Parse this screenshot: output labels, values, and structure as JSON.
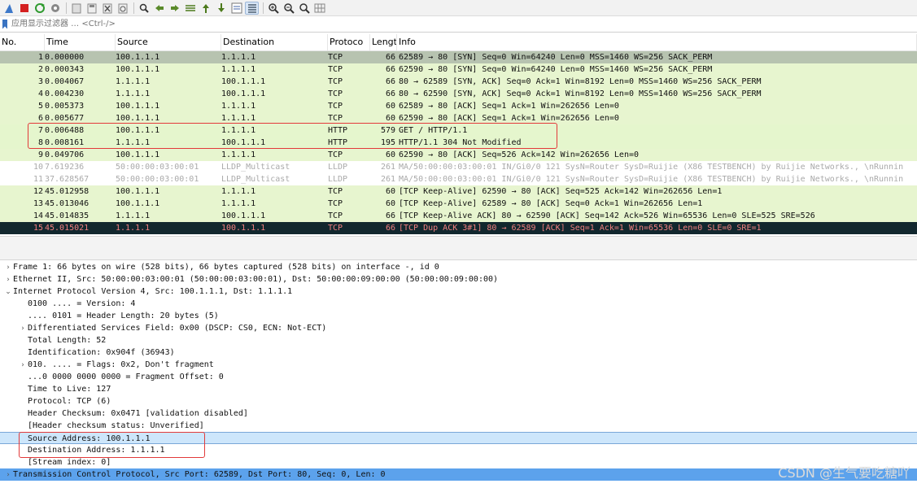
{
  "toolbar": {
    "icons": [
      "shark-fin-icon",
      "stop-icon",
      "restart-icon",
      "options-icon",
      "open-file-icon",
      "save-icon",
      "close-file-icon",
      "reload-icon",
      "find-icon",
      "go-back-icon",
      "go-forward-icon",
      "go-to-packet-icon",
      "first-packet-icon",
      "last-packet-icon",
      "autoscroll-icon",
      "colorize-icon",
      "zoom-in-icon",
      "zoom-out-icon",
      "zoom-normal-icon",
      "resize-columns-icon"
    ]
  },
  "filter": {
    "placeholder": "应用显示过滤器 … <Ctrl-/>"
  },
  "columns": {
    "no": "No.",
    "time": "Time",
    "source": "Source",
    "destination": "Destination",
    "protocol": "Protoco",
    "length": "Lengt",
    "info": "Info"
  },
  "packets": [
    {
      "no": "1",
      "time": "0.000000",
      "src": "100.1.1.1",
      "dst": "1.1.1.1",
      "proto": "TCP",
      "len": "66",
      "info": "62589 → 80 [SYN] Seq=0 Win=64240 Len=0 MSS=1460 WS=256 SACK_PERM",
      "style": "selrow"
    },
    {
      "no": "2",
      "time": "0.000343",
      "src": "100.1.1.1",
      "dst": "1.1.1.1",
      "proto": "TCP",
      "len": "66",
      "info": "62590 → 80 [SYN] Seq=0 Win=64240 Len=0 MSS=1460 WS=256 SACK_PERM",
      "style": "tcp"
    },
    {
      "no": "3",
      "time": "0.004067",
      "src": "1.1.1.1",
      "dst": "100.1.1.1",
      "proto": "TCP",
      "len": "66",
      "info": "80 → 62589 [SYN, ACK] Seq=0 Ack=1 Win=8192 Len=0 MSS=1460 WS=256 SACK_PERM",
      "style": "tcp"
    },
    {
      "no": "4",
      "time": "0.004230",
      "src": "1.1.1.1",
      "dst": "100.1.1.1",
      "proto": "TCP",
      "len": "66",
      "info": "80 → 62590 [SYN, ACK] Seq=0 Ack=1 Win=8192 Len=0 MSS=1460 WS=256 SACK_PERM",
      "style": "tcp"
    },
    {
      "no": "5",
      "time": "0.005373",
      "src": "100.1.1.1",
      "dst": "1.1.1.1",
      "proto": "TCP",
      "len": "60",
      "info": "62589 → 80 [ACK] Seq=1 Ack=1 Win=262656 Len=0",
      "style": "tcp"
    },
    {
      "no": "6",
      "time": "0.005677",
      "src": "100.1.1.1",
      "dst": "1.1.1.1",
      "proto": "TCP",
      "len": "60",
      "info": "62590 → 80 [ACK] Seq=1 Ack=1 Win=262656 Len=0",
      "style": "tcp"
    },
    {
      "no": "7",
      "time": "0.006488",
      "src": "100.1.1.1",
      "dst": "1.1.1.1",
      "proto": "HTTP",
      "len": "579",
      "info": "GET / HTTP/1.1",
      "style": "http"
    },
    {
      "no": "8",
      "time": "0.008161",
      "src": "1.1.1.1",
      "dst": "100.1.1.1",
      "proto": "HTTP",
      "len": "195",
      "info": "HTTP/1.1 304 Not Modified",
      "style": "http"
    },
    {
      "no": "9",
      "time": "0.049706",
      "src": "100.1.1.1",
      "dst": "1.1.1.1",
      "proto": "TCP",
      "len": "60",
      "info": "62590 → 80 [ACK] Seq=526 Ack=142 Win=262656 Len=0",
      "style": "tcp"
    },
    {
      "no": "10",
      "time": "7.619236",
      "src": "50:00:00:03:00:01",
      "dst": "LLDP_Multicast",
      "proto": "LLDP",
      "len": "261",
      "info": "MA/50:00:00:03:00:01 IN/Gi0/0 121 SysN=Router SysD=Ruijie (X86 TESTBENCH) by Ruijie Networks., \\nRunnin",
      "style": "lldp"
    },
    {
      "no": "11",
      "time": "37.628567",
      "src": "50:00:00:03:00:01",
      "dst": "LLDP_Multicast",
      "proto": "LLDP",
      "len": "261",
      "info": "MA/50:00:00:03:00:01 IN/Gi0/0 121 SysN=Router SysD=Ruijie (X86 TESTBENCH) by Ruijie Networks., \\nRunnin",
      "style": "lldp"
    },
    {
      "no": "12",
      "time": "45.012958",
      "src": "100.1.1.1",
      "dst": "1.1.1.1",
      "proto": "TCP",
      "len": "60",
      "info": "[TCP Keep-Alive] 62590 → 80 [ACK] Seq=525 Ack=142 Win=262656 Len=1",
      "style": "tcp"
    },
    {
      "no": "13",
      "time": "45.013046",
      "src": "100.1.1.1",
      "dst": "1.1.1.1",
      "proto": "TCP",
      "len": "60",
      "info": "[TCP Keep-Alive] 62589 → 80 [ACK] Seq=0 Ack=1 Win=262656 Len=1",
      "style": "tcp"
    },
    {
      "no": "14",
      "time": "45.014835",
      "src": "1.1.1.1",
      "dst": "100.1.1.1",
      "proto": "TCP",
      "len": "66",
      "info": "[TCP Keep-Alive ACK] 80 → 62590 [ACK] Seq=142 Ack=526 Win=65536 Len=0 SLE=525 SRE=526",
      "style": "tcp"
    },
    {
      "no": "15",
      "time": "45.015021",
      "src": "1.1.1.1",
      "dst": "100.1.1.1",
      "proto": "TCP",
      "len": "66",
      "info": "[TCP Dup ACK 3#1] 80 → 62589 [ACK] Seq=1 Ack=1 Win=65536 Len=0 SLE=0 SRE=1",
      "style": "dark"
    }
  ],
  "details": [
    {
      "indent": 0,
      "arrow": ">",
      "text": "Frame 1: 66 bytes on wire (528 bits), 66 bytes captured (528 bits) on interface -, id 0",
      "style": ""
    },
    {
      "indent": 0,
      "arrow": ">",
      "text": "Ethernet II, Src: 50:00:00:03:00:01 (50:00:00:03:00:01), Dst: 50:00:00:09:00:00 (50:00:00:09:00:00)",
      "style": ""
    },
    {
      "indent": 0,
      "arrow": "v",
      "text": "Internet Protocol Version 4, Src: 100.1.1.1, Dst: 1.1.1.1",
      "style": ""
    },
    {
      "indent": 1,
      "arrow": "",
      "text": "0100 .... = Version: 4",
      "style": ""
    },
    {
      "indent": 1,
      "arrow": "",
      "text": ".... 0101 = Header Length: 20 bytes (5)",
      "style": ""
    },
    {
      "indent": 1,
      "arrow": ">",
      "text": "Differentiated Services Field: 0x00 (DSCP: CS0, ECN: Not-ECT)",
      "style": ""
    },
    {
      "indent": 1,
      "arrow": "",
      "text": "Total Length: 52",
      "style": ""
    },
    {
      "indent": 1,
      "arrow": "",
      "text": "Identification: 0x904f (36943)",
      "style": ""
    },
    {
      "indent": 1,
      "arrow": ">",
      "text": "010. .... = Flags: 0x2, Don't fragment",
      "style": ""
    },
    {
      "indent": 1,
      "arrow": "",
      "text": "...0 0000 0000 0000 = Fragment Offset: 0",
      "style": ""
    },
    {
      "indent": 1,
      "arrow": "",
      "text": "Time to Live: 127",
      "style": ""
    },
    {
      "indent": 1,
      "arrow": "",
      "text": "Protocol: TCP (6)",
      "style": ""
    },
    {
      "indent": 1,
      "arrow": "",
      "text": "Header Checksum: 0x0471 [validation disabled]",
      "style": ""
    },
    {
      "indent": 1,
      "arrow": "",
      "text": "[Header checksum status: Unverified]",
      "style": ""
    },
    {
      "indent": 1,
      "arrow": "",
      "text": "Source Address: 100.1.1.1",
      "style": "hl"
    },
    {
      "indent": 1,
      "arrow": "",
      "text": "Destination Address: 1.1.1.1",
      "style": ""
    },
    {
      "indent": 1,
      "arrow": "",
      "text": "[Stream index: 0]",
      "style": ""
    },
    {
      "indent": 0,
      "arrow": ">",
      "text": "Transmission Control Protocol, Src Port: 62589, Dst Port: 80, Seq: 0, Len: 0",
      "style": "sel"
    }
  ],
  "watermark": "CSDN @生气要吃糖吖"
}
